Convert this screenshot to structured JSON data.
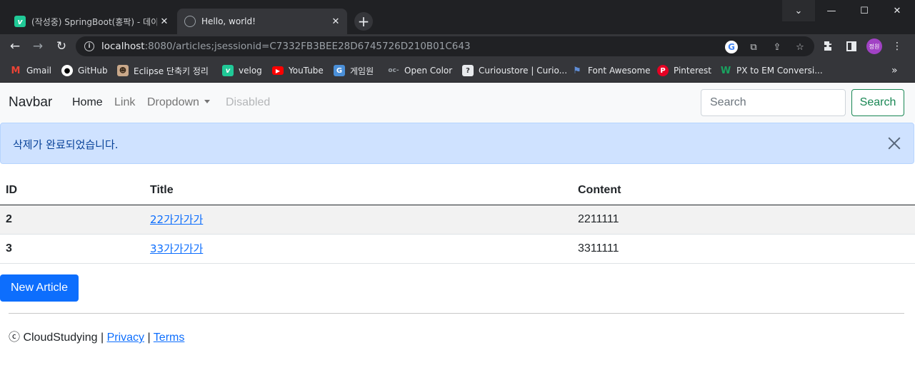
{
  "browser": {
    "tabs": [
      {
        "title": "(작성중) SpringBoot(홍팍) - 데이",
        "favicon": "velog-icon"
      },
      {
        "title": "Hello, world!",
        "favicon": "globe-icon"
      }
    ],
    "tab_close_glyph": "✕",
    "new_tab_glyph": "+",
    "window_controls": {
      "list": "⌄",
      "minimize": "—",
      "maximize": "☐",
      "close": "✕"
    },
    "nav": {
      "back": "←",
      "forward": "→",
      "reload": "↻"
    },
    "url_host": "localhost",
    "url_rest": ":8080/articles;jsessionid=C7332FB3BEE28D6745726D210B01C643",
    "profile_initials": "정원",
    "bookmarks": [
      {
        "label": "Gmail",
        "icon": "gmail-icon"
      },
      {
        "label": "GitHub",
        "icon": "github-icon"
      },
      {
        "label": "Eclipse 단축키 정리",
        "icon": "eclipse-icon"
      },
      {
        "label": "velog",
        "icon": "velog-icon"
      },
      {
        "label": "YouTube",
        "icon": "youtube-icon"
      },
      {
        "label": "게임원",
        "icon": "game-icon"
      },
      {
        "label": "Open Color",
        "icon": "oc-icon"
      },
      {
        "label": "Curioustore | Curio...",
        "icon": "question-icon"
      },
      {
        "label": "Font Awesome",
        "icon": "flag-icon"
      },
      {
        "label": "Pinterest",
        "icon": "pinterest-icon"
      },
      {
        "label": "PX to EM Conversi...",
        "icon": "w-icon"
      }
    ],
    "bookmarks_more": "»"
  },
  "navbar": {
    "brand": "Navbar",
    "links": [
      "Home",
      "Link",
      "Dropdown",
      "Disabled"
    ],
    "search_placeholder": "Search",
    "search_button": "Search"
  },
  "alert": {
    "message": "삭제가 완료되었습니다."
  },
  "table": {
    "headers": [
      "ID",
      "Title",
      "Content"
    ],
    "rows": [
      {
        "id": "2",
        "title": "22가가가가",
        "content": "2211111"
      },
      {
        "id": "3",
        "title": "33가가가가",
        "content": "3311111"
      }
    ]
  },
  "new_article_button": "New Article",
  "footer": {
    "copyright": "ⓒ CloudStudying | ",
    "privacy": "Privacy",
    "separator": " | ",
    "terms": "Terms"
  },
  "colors": {
    "primary": "#0d6efd",
    "success": "#198754",
    "alert_bg": "#cfe2ff",
    "alert_text": "#084298",
    "chrome_dark": "#202124",
    "chrome_toolbar": "#35363a"
  }
}
